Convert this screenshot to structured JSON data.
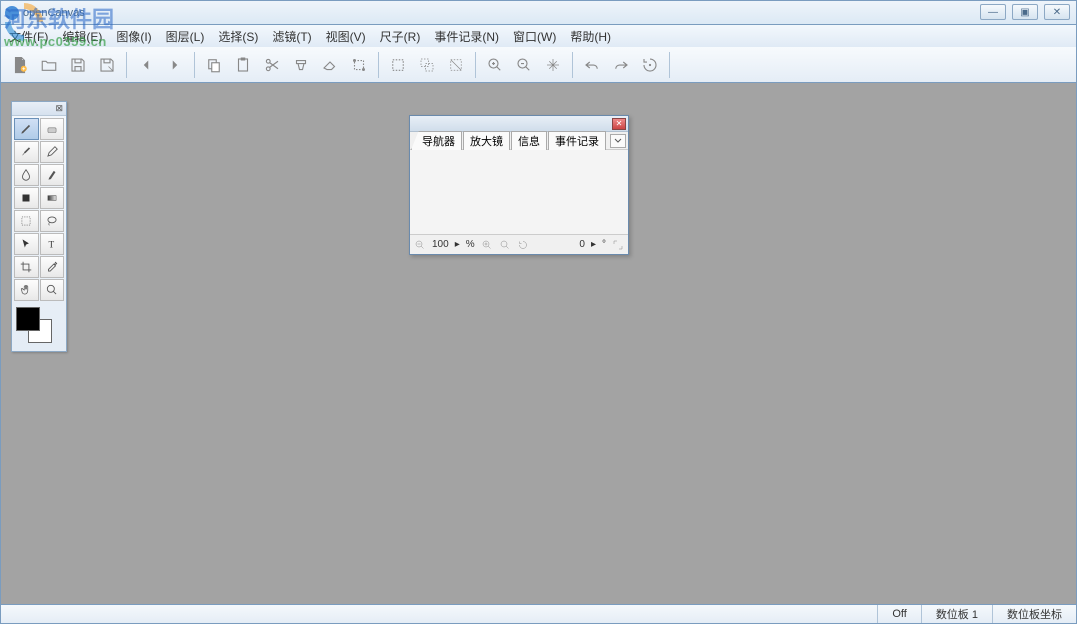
{
  "window": {
    "title": "openCanvas",
    "controls": {
      "min": "—",
      "max": "▣",
      "close": "✕"
    }
  },
  "menu": {
    "items": [
      "文件(F)",
      "编辑(E)",
      "图像(I)",
      "图层(L)",
      "选择(S)",
      "滤镜(T)",
      "视图(V)",
      "尺子(R)",
      "事件记录(N)",
      "窗口(W)",
      "帮助(H)"
    ]
  },
  "toolbar": {
    "groups": [
      [
        "new-file",
        "open-file",
        "save-file",
        "save-as"
      ],
      [
        "nav-prev",
        "nav-next"
      ],
      [
        "copy",
        "paste",
        "cut",
        "clear",
        "fill",
        "transform"
      ],
      [
        "select-rect",
        "select-free",
        "select-invert"
      ],
      [
        "zoom-in",
        "zoom-out",
        "fit"
      ],
      [
        "undo",
        "redo",
        "history"
      ]
    ]
  },
  "tools": {
    "items": [
      "pencil",
      "eraser",
      "brush",
      "pen",
      "watercolor",
      "marker",
      "bucket",
      "gradient",
      "select-rect",
      "lasso",
      "move",
      "text",
      "crop",
      "eyedropper",
      "hand",
      "zoom"
    ],
    "active": "pencil",
    "fg_color": "#000000",
    "bg_color": "#ffffff"
  },
  "navigator": {
    "tabs": [
      "导航器",
      "放大镜",
      "信息",
      "事件记录"
    ],
    "zoom_value": "100",
    "zoom_unit": "%",
    "angle_value": "0",
    "angle_unit": "°",
    "arrow": "▸"
  },
  "statusbar": {
    "off": "Off",
    "tablet": "数位板 1",
    "coords": "数位板坐标"
  },
  "watermark": {
    "line1": "河东软件园",
    "line2": "www.pc0359.cn"
  }
}
